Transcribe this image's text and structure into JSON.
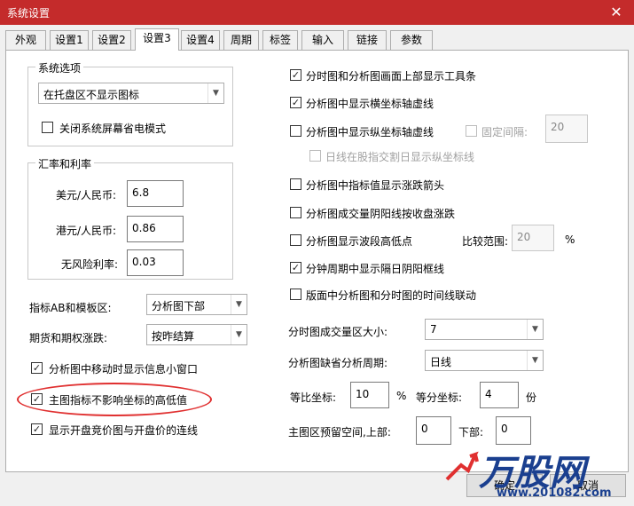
{
  "window": {
    "title": "系统设置"
  },
  "tabs": [
    "外观",
    "设置1",
    "设置2",
    "设置3",
    "设置4",
    "周期",
    "标签",
    "输入",
    "链接",
    "参数"
  ],
  "left": {
    "system_options": {
      "title": "系统选项",
      "tray_combo": "在托盘区不显示图标",
      "screensaver_label": "关闭系统屏幕省电模式"
    },
    "rates": {
      "title": "汇率和利率",
      "usd_label": "美元/人民币:",
      "usd_value": "6.8",
      "hkd_label": "港元/人民币:",
      "hkd_value": "0.86",
      "rf_label": "无风险利率:",
      "rf_value": "0.03"
    },
    "indicator_ab": {
      "label": "指标AB和模板区:",
      "value": "分析图下部"
    },
    "futures": {
      "label": "期货和期权涨跌:",
      "value": "按昨结算"
    },
    "checks": {
      "info_window": "分析图中移动时显示信息小窗口",
      "main_indicator": "主图指标不影响坐标的高低值",
      "auction_line": "显示开盘竞价图与开盘价的连线"
    }
  },
  "right": {
    "checks": {
      "toolbar_top": "分时图和分析图画面上部显示工具条",
      "h_axis_dotted": "分析图中显示横坐标轴虚线",
      "v_axis_dotted": "分析图中显示纵坐标轴虚线",
      "fixed_interval": "固定间隔:",
      "daily_line": "日线在股指交割日显示纵坐标线",
      "up_down_arrow": "分析图中指标值显示涨跌箭头",
      "volume_color": "分析图成交量阴阳线按收盘涨跌",
      "wave_high_low": "分析图显示波段高低点",
      "minute_frame": "分钟周期中显示隔日阴阳框线",
      "time_link": "版面中分析图和分时图的时间线联动"
    },
    "fixed_interval_value": "20",
    "compare_label": "比较范围:",
    "compare_value": "20",
    "compare_unit": "%",
    "minute_volume": {
      "label": "分时图成交量区大小:",
      "value": "7"
    },
    "default_period": {
      "label": "分析图缺省分析周期:",
      "value": "日线"
    },
    "ratio": {
      "label": "等比坐标:",
      "value": "10",
      "unit": "%"
    },
    "equal": {
      "label": "等分坐标:",
      "value": "4",
      "unit": "份"
    },
    "reserve": {
      "label": "主图区预留空间,上部:",
      "top_value": "0",
      "bottom_label": "下部:",
      "bottom_value": "0"
    }
  },
  "footer": {
    "ok": "确定",
    "cancel": "取消"
  },
  "watermark": {
    "brand": "万股网",
    "url": "www.201082.com"
  },
  "colors": {
    "titlebar": "#c42b2b",
    "annotation": "#e03030",
    "watermark": "#1a3f8f"
  }
}
